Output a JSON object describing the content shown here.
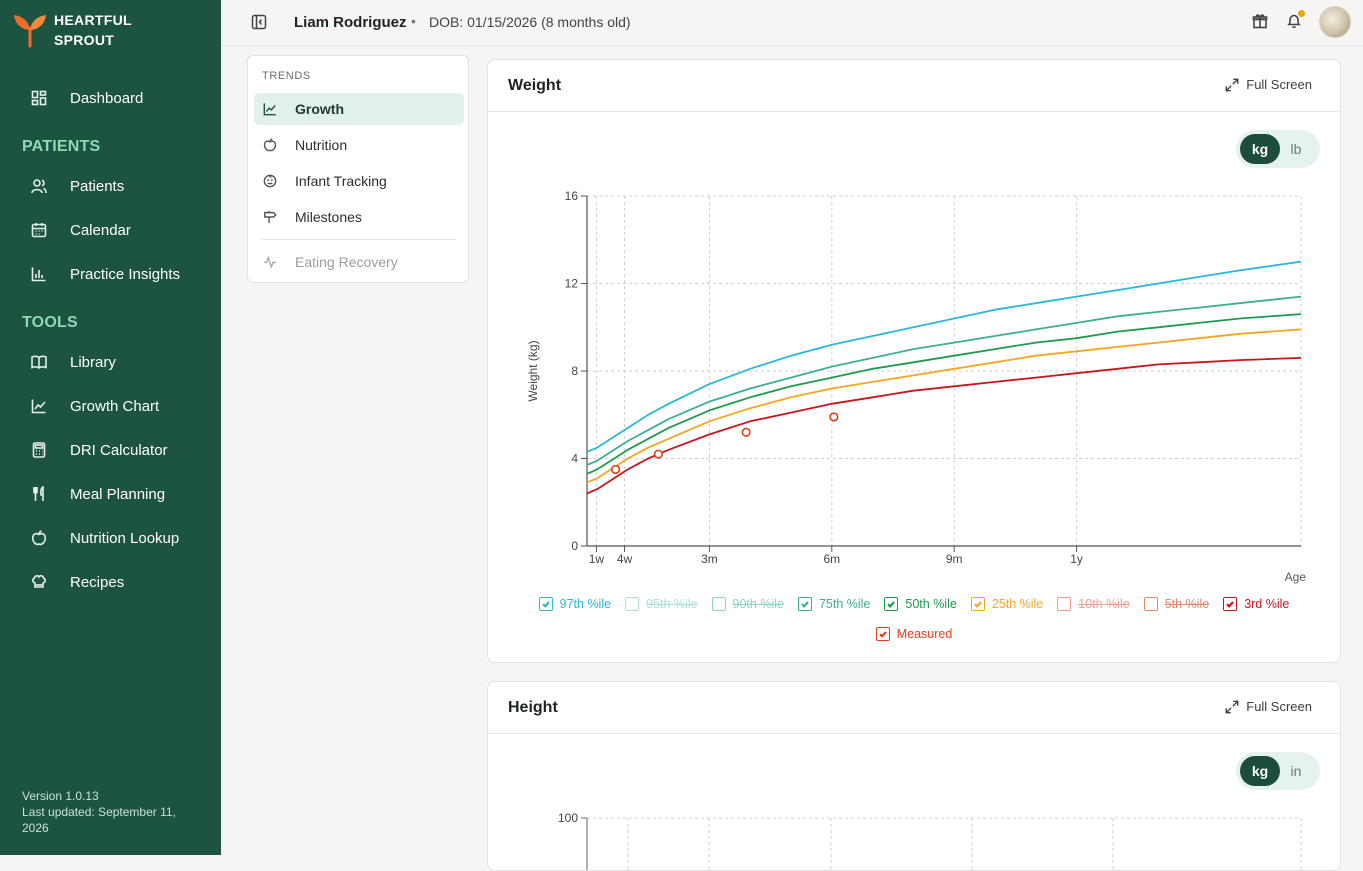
{
  "brand": {
    "line1": "HEARTFUL",
    "line2": "SPROUT"
  },
  "sidebar": {
    "top_items": [
      {
        "label": "Dashboard",
        "icon": "dashboard-icon"
      }
    ],
    "patients_title": "PATIENTS",
    "patient_items": [
      {
        "label": "Patients",
        "icon": "users-icon"
      },
      {
        "label": "Calendar",
        "icon": "calendar-icon"
      },
      {
        "label": "Practice Insights",
        "icon": "bar-chart-icon"
      }
    ],
    "tools_title": "TOOLS",
    "tool_items": [
      {
        "label": "Library",
        "icon": "book-icon"
      },
      {
        "label": "Growth Chart",
        "icon": "line-chart-icon"
      },
      {
        "label": "DRI Calculator",
        "icon": "calculator-icon"
      },
      {
        "label": "Meal Planning",
        "icon": "utensils-icon"
      },
      {
        "label": "Nutrition Lookup",
        "icon": "apple-icon"
      },
      {
        "label": "Recipes",
        "icon": "chef-hat-icon"
      }
    ],
    "version": "Version 1.0.13",
    "updated": "Last updated: September 11, 2026"
  },
  "header": {
    "patient_name": "Liam Rodriguez",
    "separator": "•",
    "dob": "DOB: 01/15/2026 (8 months old)"
  },
  "trends": {
    "title": "TRENDS",
    "items": [
      {
        "label": "Growth",
        "icon": "growth-icon",
        "state": "active"
      },
      {
        "label": "Nutrition",
        "icon": "apple-icon",
        "state": "normal"
      },
      {
        "label": "Infant Tracking",
        "icon": "baby-icon",
        "state": "normal"
      },
      {
        "label": "Milestones",
        "icon": "signpost-icon",
        "state": "normal"
      },
      {
        "label": "Eating Recovery",
        "icon": "activity-icon",
        "state": "disabled"
      }
    ]
  },
  "weight_card": {
    "title": "Weight",
    "fullscreen": "Full Screen",
    "units": [
      "kg",
      "lb"
    ],
    "selected_unit": "kg",
    "legend": [
      {
        "label": "97th %ile",
        "color": "#2bb7d6",
        "checked": true
      },
      {
        "label": "95th %ile",
        "color": "#8fd6cc",
        "checked": false
      },
      {
        "label": "90th %ile",
        "color": "#6cc3b2",
        "checked": false
      },
      {
        "label": "75th %ile",
        "color": "#3fae93",
        "checked": true
      },
      {
        "label": "50th %ile",
        "color": "#1f9a4e",
        "checked": true
      },
      {
        "label": "25th %ile",
        "color": "#f4a623",
        "checked": true
      },
      {
        "label": "10th %ile",
        "color": "#f0806a",
        "checked": false
      },
      {
        "label": "5th %ile",
        "color": "#e35a3a",
        "checked": false
      },
      {
        "label": "3rd %ile",
        "color": "#c8161c",
        "checked": true
      },
      {
        "label": "Measured",
        "color": "#e0401e",
        "checked": true
      }
    ]
  },
  "height_card": {
    "title": "Height",
    "fullscreen": "Full Screen",
    "units": [
      "kg",
      "in"
    ],
    "selected_unit": "kg",
    "y_top_tick": "100"
  },
  "chart_data": {
    "type": "line",
    "title": "Weight",
    "xlabel": "Age",
    "ylabel": "Weight (kg)",
    "x_unit": "months",
    "xlim": [
      0,
      17.5
    ],
    "ylim": [
      0,
      16
    ],
    "y_ticks": [
      0,
      4,
      8,
      12,
      16
    ],
    "x_ticks": [
      {
        "value": 0.23,
        "label": "1w"
      },
      {
        "value": 0.92,
        "label": "4w"
      },
      {
        "value": 3,
        "label": "3m"
      },
      {
        "value": 6,
        "label": "6m"
      },
      {
        "value": 9,
        "label": "9m"
      },
      {
        "value": 12,
        "label": "1y"
      }
    ],
    "grid": true,
    "x_samples": [
      0,
      0.25,
      0.5,
      1,
      1.5,
      2,
      3,
      4,
      5,
      6,
      7,
      8,
      9,
      10,
      11,
      12,
      13,
      14,
      15,
      16,
      17.5
    ],
    "series": [
      {
        "name": "97th %ile",
        "color": "#2bb7d6",
        "values": [
          4.3,
          4.5,
          4.8,
          5.4,
          6.0,
          6.5,
          7.4,
          8.1,
          8.7,
          9.2,
          9.6,
          10.0,
          10.4,
          10.8,
          11.1,
          11.4,
          11.7,
          12.0,
          12.3,
          12.6,
          13.0
        ]
      },
      {
        "name": "75th %ile",
        "color": "#3fae93",
        "values": [
          3.7,
          3.9,
          4.2,
          4.8,
          5.3,
          5.8,
          6.6,
          7.2,
          7.7,
          8.2,
          8.6,
          9.0,
          9.3,
          9.6,
          9.9,
          10.2,
          10.5,
          10.7,
          10.9,
          11.1,
          11.4
        ]
      },
      {
        "name": "50th %ile",
        "color": "#1f9a4e",
        "values": [
          3.3,
          3.5,
          3.8,
          4.4,
          4.9,
          5.4,
          6.2,
          6.8,
          7.3,
          7.7,
          8.1,
          8.4,
          8.7,
          9.0,
          9.3,
          9.5,
          9.8,
          10.0,
          10.2,
          10.4,
          10.6
        ]
      },
      {
        "name": "25th %ile",
        "color": "#f4a623",
        "values": [
          2.9,
          3.1,
          3.4,
          4.0,
          4.5,
          4.9,
          5.7,
          6.3,
          6.8,
          7.2,
          7.5,
          7.8,
          8.1,
          8.4,
          8.7,
          8.9,
          9.1,
          9.3,
          9.5,
          9.7,
          9.9
        ]
      },
      {
        "name": "3rd %ile",
        "color": "#c8161c",
        "values": [
          2.4,
          2.6,
          2.9,
          3.5,
          4.0,
          4.4,
          5.1,
          5.7,
          6.1,
          6.5,
          6.8,
          7.1,
          7.3,
          7.5,
          7.7,
          7.9,
          8.1,
          8.3,
          8.4,
          8.5,
          8.6
        ]
      }
    ],
    "measured": {
      "name": "Measured",
      "color": "#e0401e",
      "points": [
        {
          "x": 0.7,
          "y": 3.5
        },
        {
          "x": 1.75,
          "y": 4.2
        },
        {
          "x": 3.9,
          "y": 5.2
        },
        {
          "x": 6.05,
          "y": 5.9
        }
      ]
    }
  }
}
